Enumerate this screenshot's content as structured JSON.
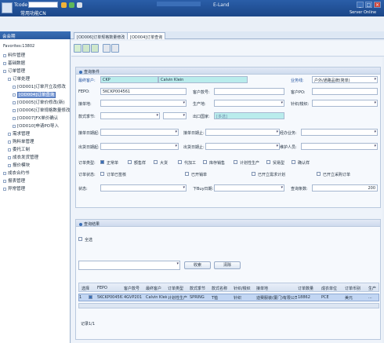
{
  "topbar": {
    "tcode_label": "Tcode",
    "subtitle": "常用功能CN",
    "center_title": "E-Land",
    "win_buttons": [
      "_",
      "□",
      "×"
    ]
  },
  "server": {
    "label": "Server Online"
  },
  "sidebar": {
    "header": "会会期",
    "favorites": "Favorites:13802",
    "items": [
      {
        "label": "料件管理",
        "indent": 0
      },
      {
        "label": "基础数据",
        "indent": 0
      },
      {
        "label": "订单管理",
        "indent": 0
      },
      {
        "label": "订单处理",
        "indent": 1
      },
      {
        "label": "[OD001]订单开立及修改",
        "indent": 2
      },
      {
        "label": "[OD004]订单查询",
        "indent": 2,
        "selected": true
      },
      {
        "label": "[OD005]订单价修改(新)",
        "indent": 2
      },
      {
        "label": "[OD006]订单规格数量修改",
        "indent": 2
      },
      {
        "label": "[OD007]FX单价确认",
        "indent": 2
      },
      {
        "label": "[OD010]申请PO导入",
        "indent": 2
      },
      {
        "label": "需求管理",
        "indent": 1
      },
      {
        "label": "购料单管理",
        "indent": 1
      },
      {
        "label": "委托工制",
        "indent": 1
      },
      {
        "label": "成衣发货管理",
        "indent": 1
      },
      {
        "label": "报价模块",
        "indent": 1
      },
      {
        "label": "成衣合约书",
        "indent": 0
      },
      {
        "label": "报表管理",
        "indent": 0
      },
      {
        "label": "异常管理",
        "indent": 0
      }
    ]
  },
  "tabs": [
    {
      "label": "[OD006]订单规格数量修改"
    },
    {
      "label": "[OD004]订单查询",
      "active": true
    }
  ],
  "query": {
    "title": "查询条件",
    "customer_label": "最终客户:",
    "customer_code": "CKP",
    "customer_name": "Calvin Klein",
    "business_label": "业务线:",
    "business_value": "户外/通路品牌(简单)",
    "fepo_label": "FEPO:",
    "fepo_value": "5KCKP004561",
    "cust_no_label": "客户款号:",
    "cust_po_label": "客户PO:",
    "ship_label": "接单地:",
    "prod_label": "生产地:",
    "knit_label": "针织/梭织:",
    "style_season_label": "款式季节:",
    "export_label": "出口国家:",
    "export_placeholder": "[多选]",
    "order_date_label": "接单日期起:",
    "order_date_to_label": "接单日期止:",
    "brand_owner_label": "经办业务:",
    "ship_date_label": "出货日期起:",
    "ship_date_to_label": "出货日期止:",
    "creator_label": "维护人员:",
    "order_type_label": "订单类型:",
    "order_types": [
      "正常单",
      "额售样",
      "大货",
      "代加工",
      "库存销售",
      "计划性生产",
      "贸易型",
      "确认样"
    ],
    "order_types_checked": [
      true,
      false,
      false,
      false,
      false,
      false,
      false,
      false
    ],
    "order_status_label": "订单状态:",
    "order_statuses": [
      "订单已签核",
      "已开销单",
      "已开立需求计划",
      "已开立采购订单"
    ],
    "state_label": "状态:",
    "purchase_label": "下Buy日期:",
    "qty_label": "查询条数:",
    "qty_value": "200"
  },
  "results": {
    "title": "查询结果",
    "select_all": "全选",
    "search_btn": "收索",
    "clear_btn": "清除",
    "columns": [
      "选择",
      "FEPO",
      "客户款号",
      "最终客户",
      "订单类型",
      "款式季节",
      "款式名称",
      "针织/梭织",
      "接单地",
      "订单数量",
      "成衣单位",
      "订单币别",
      "生产"
    ],
    "rows": [
      {
        "idx": "1",
        "checked": true,
        "cells": [
          "5KCKP004561",
          "4GVP201",
          "Calvin Klein",
          "计划性生产",
          "SPRING",
          "T恤",
          "针织",
          "迪赛服装(厦门)有限公司",
          "18862",
          "PCE",
          "美元",
          "..."
        ]
      }
    ],
    "footer": "记录1/1"
  }
}
